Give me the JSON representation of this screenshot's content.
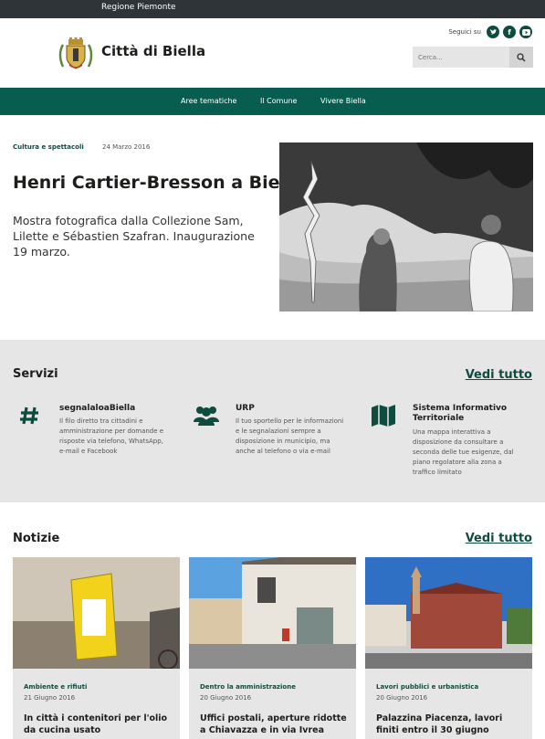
{
  "topbar": {
    "region": "Regione Piemonte"
  },
  "header": {
    "site_name": "Città di Biella",
    "social_label": "Seguici su",
    "search_placeholder": "Cerca..."
  },
  "nav": {
    "items": [
      "Aree tematiche",
      "Il Comune",
      "Vivere Biella"
    ]
  },
  "hero": {
    "category": "Cultura e spettacoli",
    "date": "24 Marzo 2016",
    "title": "Henri Cartier-Bresson a Biella",
    "description": "Mostra fotografica dalla Collezione Sam, Lilette e Sébastien Szafran. Inaugurazione 19 marzo."
  },
  "servizi": {
    "title": "Servizi",
    "see_all": "Vedi tutto",
    "items": [
      {
        "icon": "hashtag-icon",
        "name": "segnalaloaBiella",
        "text": "Il filo diretto tra cittadini e amministrazione per domande e risposte via telefono, WhatsApp, e-mail e Facebook"
      },
      {
        "icon": "people-icon",
        "name": "URP",
        "text": "Il tuo sportello per le informazioni e le segnalazioni sempre a disposizione in municipio, ma anche al telefono o via e-mail"
      },
      {
        "icon": "map-icon",
        "name": "Sistema Informativo Territoriale",
        "text": "Una mappa interattiva a disposizione da consultare a seconda delle tue esigenze, dal piano regolatore alla zona a traffico limitato"
      }
    ]
  },
  "notizie": {
    "title": "Notizie",
    "see_all": "Vedi tutto",
    "items": [
      {
        "category": "Ambiente e rifiuti",
        "date": "21 Giugno 2016",
        "title": "In città i contenitori per l'olio da cucina usato"
      },
      {
        "category": "Dentro la amministrazione",
        "date": "20 Giugno 2016",
        "title": "Uffici postali, aperture ridotte a Chiavazza e in via Ivrea"
      },
      {
        "category": "Lavori pubblici e urbanistica",
        "date": "20 Giugno 2016",
        "title": "Palazzina Piacenza, lavori finiti entro il 30 giugno"
      }
    ]
  },
  "colors": {
    "primary": "#075e50",
    "topbar": "#2f3438",
    "section_bg": "#e6e6e6"
  }
}
